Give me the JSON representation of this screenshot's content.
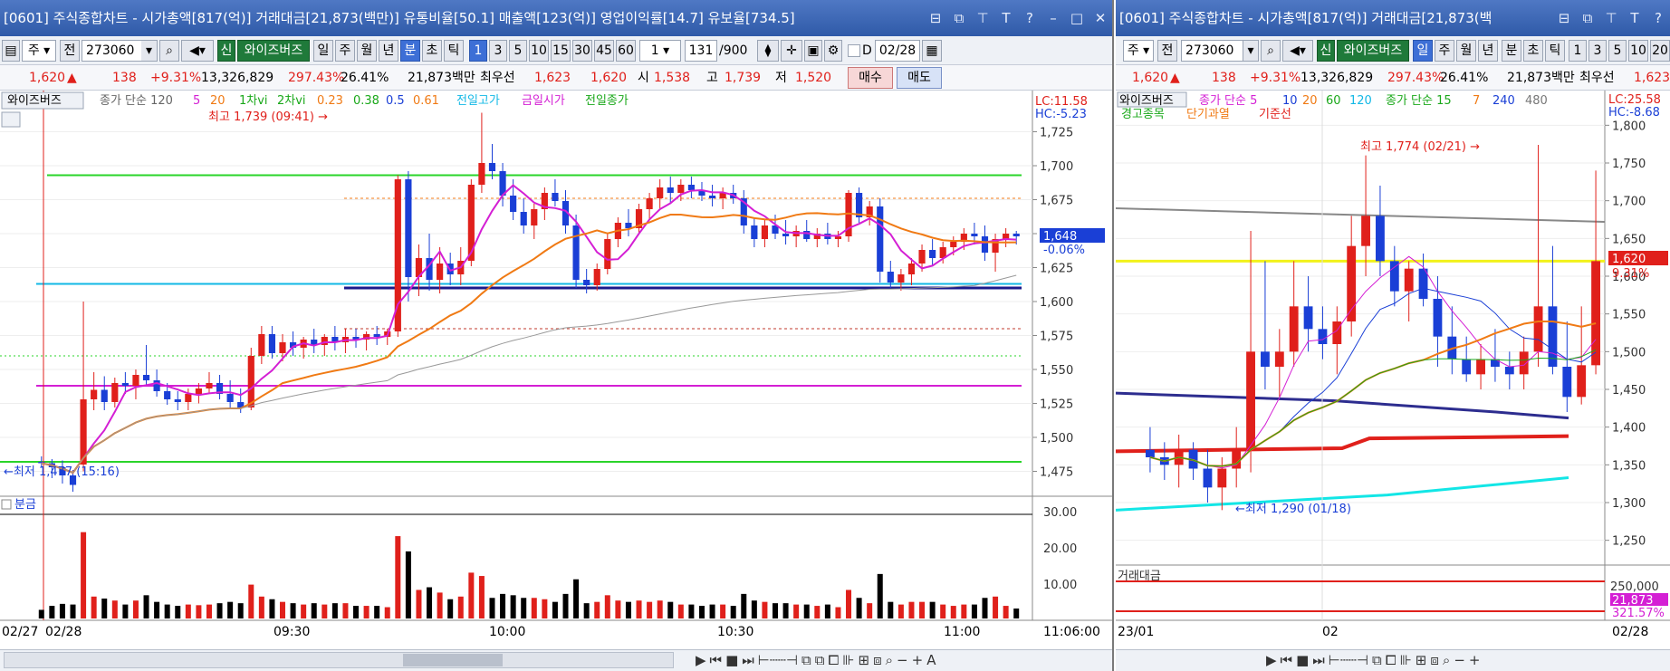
{
  "left": {
    "title": "[0601] 주식종합차트 - 시가총액[817(억)] 거래대금[21,873(백만)] 유통비율[50.1] 매출액[123(억)] 영업이익률[14.7] 유보율[734.5]",
    "toolbar": {
      "prefix": "주",
      "prev": "전",
      "code": "273060",
      "badge": "신",
      "name": "와이즈버즈",
      "periods": [
        "일",
        "주",
        "월",
        "년",
        "분",
        "초",
        "틱"
      ],
      "active_period": "분",
      "intervals": [
        "1",
        "3",
        "5",
        "10",
        "15",
        "30",
        "45",
        "60"
      ],
      "active_interval": "1",
      "count_select": "1",
      "count": "131",
      "count_total": "/900",
      "date_prefix": "D",
      "date": "02/28"
    },
    "info": {
      "price": "1,620",
      "arrow": "▲",
      "change": "138",
      "pct": "+9.31%",
      "volume": "13,326,829",
      "vol_ratio": "297.43%",
      "turnover": "26.41%",
      "amount": "21,873백만",
      "best_label": "최우선",
      "ask": "1,623",
      "bid": "1,620",
      "open_label": "시",
      "open": "1,538",
      "high_label": "고",
      "high": "1,739",
      "low_label": "저",
      "low": "1,520",
      "buy_label": "매수",
      "sell_label": "매도"
    },
    "legend": {
      "name": "와이즈버즈",
      "ma_label": "종가 단순 120",
      "ma5": "5",
      "ma20": "20",
      "vi1": "1차vi",
      "vi2": "2차vi",
      "fib023": "0.23",
      "fib038": "0.38",
      "fib05": "0.5",
      "fib061": "0.61",
      "prev_high": "전일고가",
      "today_open": "금일시가",
      "prev_close": "전일종가"
    },
    "annotations": {
      "high": "최고 1,739 (09:41) →",
      "low": "←최저 1,477 (15:16)"
    },
    "axis_box": {
      "lc": "LC:11.58",
      "hc": "HC:-5.23",
      "current": "1,648",
      "current_pct": "-0.06%"
    },
    "volume_label": "분금",
    "volume_axis": [
      "30.00",
      "20.00",
      "10.00"
    ],
    "time_axis": {
      "d1": "02/27",
      "d2": "02/28",
      "t0930": "09:30",
      "t1000": "10:00",
      "t1030": "10:30",
      "t1100": "11:00",
      "end": "11:06:00"
    }
  },
  "right": {
    "title": "[0601] 주식종합차트 - 시가총액[817(억)] 거래대금[21,873(백",
    "toolbar": {
      "prefix": "주",
      "prev": "전",
      "code": "273060",
      "badge": "신",
      "name": "와이즈버즈",
      "periods": [
        "일",
        "주",
        "월",
        "년",
        "분",
        "초",
        "틱"
      ],
      "active_period": "일",
      "intervals": [
        "1",
        "3",
        "5",
        "10",
        "20"
      ]
    },
    "info": {
      "price": "1,620",
      "arrow": "▲",
      "change": "138",
      "pct": "+9.31%",
      "volume": "13,326,829",
      "vol_ratio": "297.43%",
      "turnover": "26.41%",
      "amount": "21,873백만",
      "best_label": "최우선",
      "ask": "1,623"
    },
    "legend": {
      "name": "와이즈버즈",
      "ma_label": "종가 단순 5",
      "m10": "10",
      "m20": "20",
      "m60": "60",
      "m120": "120",
      "vma": "종가 단순 15",
      "v7": "7",
      "v240": "240",
      "v480": "480",
      "line2a": "경고종목",
      "line2b": "단기과열",
      "line2c": "기준선"
    },
    "annotations": {
      "high": "최고 1,774 (02/21) →",
      "low": "←최저 1,290 (01/18)"
    },
    "axis_box": {
      "lc": "LC:25.58",
      "hc": "HC:-8.68",
      "current": "1,620",
      "current_pct": "9.31%",
      "vol_val": "250,000",
      "amt": "21,873",
      "amt_pct": "321.57%"
    },
    "volume_label": "거래대금",
    "time_axis": {
      "m2301": "23/01",
      "m02": "02",
      "end": "02/28"
    }
  },
  "chart_data": [
    {
      "type": "candlestick",
      "title": "",
      "x_axis": [
        "02/27",
        "02/28",
        "09:30",
        "10:00",
        "10:30",
        "11:00",
        "11:06:00"
      ],
      "y_ticks": [
        1725,
        1700,
        1675,
        1650,
        1625,
        1600,
        1575,
        1550,
        1525,
        1500,
        1475
      ],
      "ylim": [
        1462,
        1742
      ],
      "candles": [
        [
          1482,
          1486,
          1478,
          1481
        ],
        [
          1481,
          1484,
          1470,
          1478
        ],
        [
          1478,
          1483,
          1466,
          1472
        ],
        [
          1472,
          1476,
          1460,
          1465
        ],
        [
          1480,
          1600,
          1475,
          1528
        ],
        [
          1528,
          1548,
          1520,
          1535
        ],
        [
          1535,
          1545,
          1520,
          1526
        ],
        [
          1526,
          1544,
          1522,
          1540
        ],
        [
          1540,
          1548,
          1532,
          1538
        ],
        [
          1538,
          1550,
          1528,
          1546
        ],
        [
          1546,
          1568,
          1538,
          1542
        ],
        [
          1542,
          1550,
          1530,
          1534
        ],
        [
          1534,
          1540,
          1524,
          1528
        ],
        [
          1528,
          1534,
          1520,
          1526
        ],
        [
          1526,
          1536,
          1520,
          1532
        ],
        [
          1532,
          1540,
          1525,
          1536
        ],
        [
          1536,
          1548,
          1532,
          1540
        ],
        [
          1540,
          1546,
          1528,
          1532
        ],
        [
          1532,
          1542,
          1522,
          1526
        ],
        [
          1526,
          1536,
          1518,
          1522
        ],
        [
          1522,
          1566,
          1520,
          1560
        ],
        [
          1560,
          1582,
          1554,
          1576
        ],
        [
          1576,
          1582,
          1558,
          1562
        ],
        [
          1562,
          1576,
          1556,
          1570
        ],
        [
          1570,
          1578,
          1560,
          1566
        ],
        [
          1566,
          1574,
          1558,
          1572
        ],
        [
          1572,
          1580,
          1562,
          1568
        ],
        [
          1568,
          1576,
          1560,
          1574
        ],
        [
          1574,
          1582,
          1564,
          1570
        ],
        [
          1570,
          1580,
          1562,
          1574
        ],
        [
          1574,
          1580,
          1566,
          1572
        ],
        [
          1572,
          1578,
          1564,
          1576
        ],
        [
          1576,
          1582,
          1568,
          1574
        ],
        [
          1574,
          1580,
          1568,
          1578
        ],
        [
          1578,
          1693,
          1574,
          1690
        ],
        [
          1690,
          1696,
          1600,
          1618
        ],
        [
          1618,
          1642,
          1604,
          1632
        ],
        [
          1632,
          1650,
          1608,
          1616
        ],
        [
          1616,
          1640,
          1606,
          1628
        ],
        [
          1628,
          1636,
          1612,
          1620
        ],
        [
          1620,
          1640,
          1612,
          1630
        ],
        [
          1630,
          1690,
          1626,
          1686
        ],
        [
          1686,
          1739,
          1680,
          1702
        ],
        [
          1702,
          1716,
          1690,
          1696
        ],
        [
          1696,
          1702,
          1670,
          1678
        ],
        [
          1678,
          1690,
          1660,
          1666
        ],
        [
          1666,
          1676,
          1650,
          1656
        ],
        [
          1656,
          1672,
          1646,
          1668
        ],
        [
          1668,
          1684,
          1660,
          1680
        ],
        [
          1680,
          1690,
          1670,
          1674
        ],
        [
          1674,
          1682,
          1650,
          1656
        ],
        [
          1656,
          1664,
          1610,
          1616
        ],
        [
          1616,
          1624,
          1606,
          1612
        ],
        [
          1612,
          1628,
          1608,
          1624
        ],
        [
          1624,
          1650,
          1620,
          1646
        ],
        [
          1646,
          1662,
          1640,
          1658
        ],
        [
          1658,
          1668,
          1648,
          1654
        ],
        [
          1654,
          1672,
          1650,
          1668
        ],
        [
          1668,
          1680,
          1660,
          1676
        ],
        [
          1676,
          1690,
          1668,
          1684
        ],
        [
          1684,
          1692,
          1672,
          1680
        ],
        [
          1680,
          1690,
          1674,
          1686
        ],
        [
          1686,
          1692,
          1676,
          1682
        ],
        [
          1682,
          1688,
          1674,
          1678
        ],
        [
          1678,
          1686,
          1670,
          1676
        ],
        [
          1676,
          1684,
          1668,
          1680
        ],
        [
          1680,
          1686,
          1672,
          1676
        ],
        [
          1676,
          1682,
          1650,
          1656
        ],
        [
          1656,
          1662,
          1640,
          1646
        ],
        [
          1646,
          1660,
          1640,
          1656
        ],
        [
          1656,
          1664,
          1646,
          1650
        ],
        [
          1650,
          1660,
          1642,
          1648
        ],
        [
          1648,
          1656,
          1640,
          1652
        ],
        [
          1652,
          1660,
          1644,
          1646
        ],
        [
          1646,
          1654,
          1640,
          1650
        ],
        [
          1650,
          1658,
          1642,
          1646
        ],
        [
          1646,
          1652,
          1640,
          1648
        ],
        [
          1648,
          1682,
          1644,
          1680
        ],
        [
          1680,
          1684,
          1658,
          1662
        ],
        [
          1662,
          1674,
          1656,
          1670
        ],
        [
          1670,
          1676,
          1614,
          1622
        ],
        [
          1622,
          1630,
          1610,
          1614
        ],
        [
          1614,
          1624,
          1608,
          1620
        ],
        [
          1620,
          1632,
          1612,
          1628
        ],
        [
          1628,
          1642,
          1622,
          1638
        ],
        [
          1638,
          1646,
          1626,
          1632
        ],
        [
          1632,
          1644,
          1628,
          1640
        ],
        [
          1640,
          1648,
          1634,
          1644
        ],
        [
          1644,
          1654,
          1638,
          1650
        ],
        [
          1650,
          1658,
          1642,
          1648
        ],
        [
          1648,
          1656,
          1630,
          1636
        ],
        [
          1636,
          1650,
          1622,
          1646
        ],
        [
          1646,
          1654,
          1640,
          1650
        ],
        [
          1650,
          1652,
          1642,
          1648
        ]
      ],
      "levels": {
        "prev_high": 1613,
        "today_open": 1538,
        "prev_close": 1482,
        "vi_green": 1693
      }
    },
    {
      "type": "candlestick",
      "title": "",
      "x_axis": [
        "23/01",
        "02",
        "02/28"
      ],
      "y_ticks": [
        1800,
        1750,
        1700,
        1650,
        1600,
        1550,
        1500,
        1450,
        1400,
        1350,
        1300,
        1250
      ],
      "ylim": [
        1228,
        1822
      ],
      "candles": [
        [
          1370,
          1400,
          1340,
          1360
        ],
        [
          1360,
          1380,
          1330,
          1350
        ],
        [
          1350,
          1390,
          1320,
          1370
        ],
        [
          1370,
          1380,
          1330,
          1345
        ],
        [
          1345,
          1370,
          1300,
          1320
        ],
        [
          1320,
          1360,
          1290,
          1345
        ],
        [
          1345,
          1400,
          1320,
          1370
        ],
        [
          1370,
          1660,
          1340,
          1500
        ],
        [
          1500,
          1620,
          1450,
          1480
        ],
        [
          1480,
          1530,
          1440,
          1500
        ],
        [
          1500,
          1620,
          1480,
          1560
        ],
        [
          1560,
          1600,
          1500,
          1530
        ],
        [
          1530,
          1560,
          1490,
          1510
        ],
        [
          1510,
          1560,
          1470,
          1540
        ],
        [
          1540,
          1680,
          1520,
          1640
        ],
        [
          1640,
          1760,
          1600,
          1680
        ],
        [
          1680,
          1720,
          1600,
          1620
        ],
        [
          1620,
          1640,
          1560,
          1580
        ],
        [
          1580,
          1620,
          1540,
          1610
        ],
        [
          1610,
          1630,
          1560,
          1570
        ],
        [
          1570,
          1600,
          1480,
          1520
        ],
        [
          1520,
          1560,
          1470,
          1490
        ],
        [
          1490,
          1520,
          1460,
          1470
        ],
        [
          1470,
          1510,
          1450,
          1490
        ],
        [
          1490,
          1530,
          1460,
          1480
        ],
        [
          1480,
          1500,
          1450,
          1470
        ],
        [
          1470,
          1520,
          1450,
          1500
        ],
        [
          1500,
          1774,
          1480,
          1560
        ],
        [
          1560,
          1640,
          1470,
          1480
        ],
        [
          1480,
          1540,
          1420,
          1440
        ],
        [
          1440,
          1560,
          1430,
          1482
        ],
        [
          1482,
          1740,
          1470,
          1620
        ]
      ],
      "levels": {
        "limit_yellow": 1620
      }
    }
  ]
}
